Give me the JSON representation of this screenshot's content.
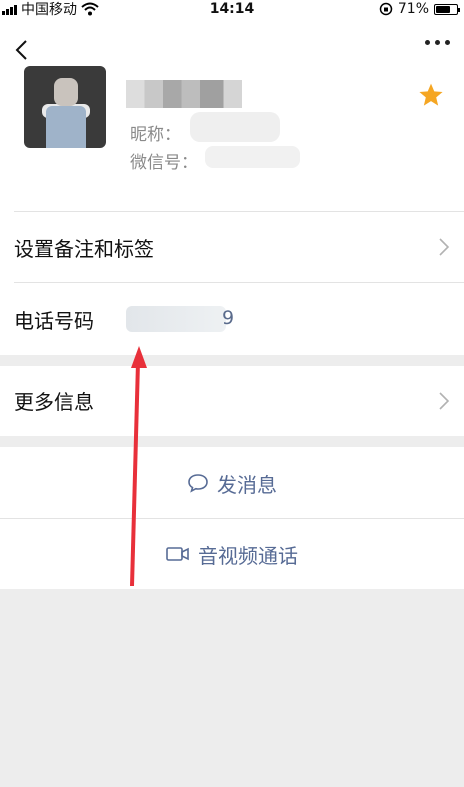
{
  "status_bar": {
    "carrier": "中国移动",
    "time": "14:14",
    "battery_percent": "71%",
    "battery_level": 0.71
  },
  "header": {
    "back_icon": "chevron-left-icon",
    "more_icon": "ellipsis-icon"
  },
  "profile": {
    "nickname_label": "昵称：",
    "wechat_id_label": "微信号：",
    "star_color": "#f5a623"
  },
  "rows": {
    "remark_tags": "设置备注和标签",
    "phone_label": "电话号码",
    "phone_visible_suffix": "9",
    "more_info": "更多信息"
  },
  "actions": {
    "send_message": "发消息",
    "video_call": "音视频通话"
  },
  "colors": {
    "link": "#576b95",
    "annotation_arrow": "#e8303a"
  }
}
